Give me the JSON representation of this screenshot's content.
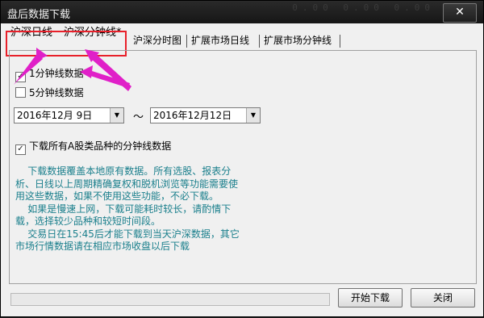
{
  "window": {
    "title": "盘后数据下载",
    "close_glyph": "✕"
  },
  "tabs": [
    {
      "label": "沪深日线"
    },
    {
      "label": "沪深分钟线*"
    },
    {
      "label": "沪深分时图"
    },
    {
      "label": "扩展市场日线"
    },
    {
      "label": "扩展市场分钟线"
    }
  ],
  "options": {
    "one_min": {
      "label": "1分钟线数据",
      "checked": true
    },
    "five_min": {
      "label": "5分钟线数据",
      "checked": false
    },
    "all_a_shares": {
      "label": "下载所有A股类品种的分钟线数据",
      "checked": true
    }
  },
  "date_range": {
    "start": "2016年12月  9日",
    "end": "2016年12月12日",
    "separator": "～"
  },
  "description": "    下载数据覆盖本地原有数据。所有选股、报表分\n析、日线以上周期精确复权和脱机浏览等功能需要使\n用这些数据，如果不使用这些功能，不必下载。\n    如果是慢速上网，下载可能耗时较长，请酌情下\n载，选择较少品种和较短时间段。\n    交易日在15:45后才能下载到当天沪深数据，其它\n市场行情数据请在相应市场收盘以后下载",
  "buttons": {
    "start": "开始下载",
    "close": "关闭"
  },
  "annotation_colors": {
    "outline": "#e8202a",
    "arrows": "#e020c8"
  },
  "icons": {
    "dropdown": "dropdown-arrow-icon",
    "check": "checkmark-icon"
  }
}
